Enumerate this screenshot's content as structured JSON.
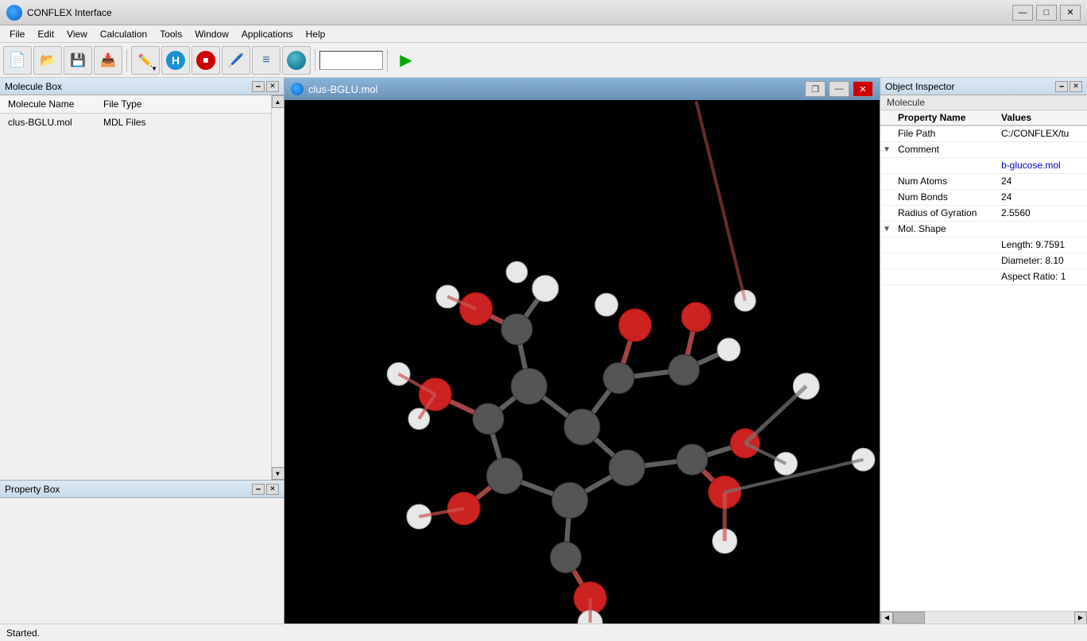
{
  "titlebar": {
    "title": "CONFLEX Interface",
    "minimize": "—",
    "maximize": "□",
    "close": "✕"
  },
  "menu": {
    "items": [
      "File",
      "Edit",
      "View",
      "Calculation",
      "Tools",
      "Window",
      "Applications",
      "Help"
    ]
  },
  "toolbar": {
    "search_placeholder": ""
  },
  "molecule_box": {
    "title": "Molecule Box",
    "columns": [
      "Molecule Name",
      "File Type"
    ],
    "rows": [
      {
        "name": "clus-BGLU.mol",
        "type": "MDL Files"
      }
    ]
  },
  "property_box": {
    "title": "Property Box"
  },
  "viewer": {
    "title": "clus-BGLU.mol",
    "minimize": "—",
    "restore": "❐",
    "close": "✕"
  },
  "object_inspector": {
    "title": "Object Inspector",
    "section": "Molecule",
    "col_property": "Property Name",
    "col_value": "Values",
    "rows": [
      {
        "indent": false,
        "expand": false,
        "prop": "File Path",
        "val": "C:/CONFLEX/tu"
      },
      {
        "indent": false,
        "expand": true,
        "prop": "Comment",
        "val": ""
      },
      {
        "indent": true,
        "expand": false,
        "prop": "",
        "val": "b-glucose.mol"
      },
      {
        "indent": false,
        "expand": false,
        "prop": "Num Atoms",
        "val": "24"
      },
      {
        "indent": false,
        "expand": false,
        "prop": "Num Bonds",
        "val": "24"
      },
      {
        "indent": false,
        "expand": false,
        "prop": "Radius of Gyration",
        "val": "2.5560"
      },
      {
        "indent": false,
        "expand": true,
        "prop": "Mol. Shape",
        "val": ""
      },
      {
        "indent": true,
        "expand": false,
        "prop": "",
        "val": "Length: 9.7591"
      },
      {
        "indent": true,
        "expand": false,
        "prop": "",
        "val": "Diameter: 8.10"
      },
      {
        "indent": true,
        "expand": false,
        "prop": "",
        "val": "Aspect Ratio: 1"
      }
    ],
    "minimize": "🗕",
    "close": "✕"
  },
  "status": {
    "text": "Started."
  }
}
